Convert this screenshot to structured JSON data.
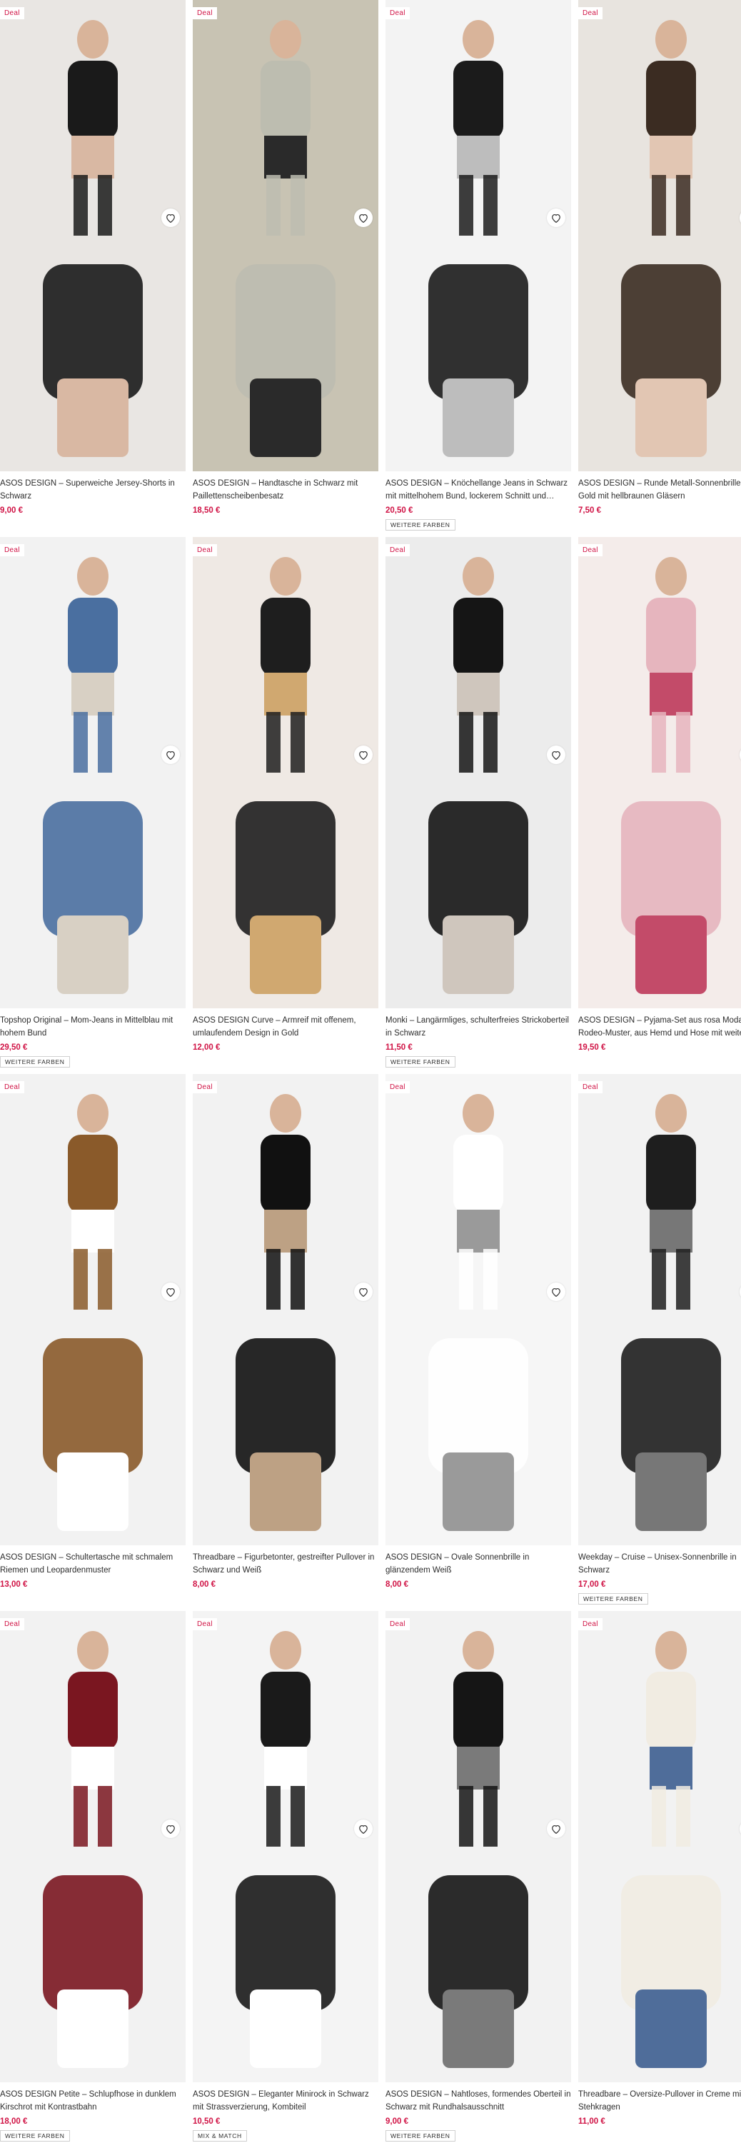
{
  "products": [
    {
      "deal": "Deal",
      "title": "ASOS DESIGN – Superweiche Jersey-Shorts in Schwarz",
      "price": "9,00 €",
      "tag": ""
    },
    {
      "deal": "Deal",
      "title": "ASOS DESIGN – Handtasche in Schwarz mit Paillettenscheibenbesatz",
      "price": "18,50 €",
      "tag": ""
    },
    {
      "deal": "Deal",
      "title": "ASOS DESIGN – Knöchellange Jeans in Schwarz mit mittelhohem Bund, lockerem Schnitt und…",
      "price": "20,50 €",
      "tag": "WEITERE FARBEN"
    },
    {
      "deal": "Deal",
      "title": "ASOS DESIGN – Runde Metall-Sonnenbrille in Gold mit hellbraunen Gläsern",
      "price": "7,50 €",
      "tag": ""
    },
    {
      "deal": "Deal",
      "title": "Topshop Original – Mom-Jeans in Mittelblau mit hohem Bund",
      "price": "29,50 €",
      "tag": "WEITERE FARBEN"
    },
    {
      "deal": "Deal",
      "title": "ASOS DESIGN Curve – Armreif mit offenem, umlaufendem Design in Gold",
      "price": "12,00 €",
      "tag": ""
    },
    {
      "deal": "Deal",
      "title": "Monki – Langärmliges, schulterfreies Strickoberteil in Schwarz",
      "price": "11,50 €",
      "tag": "WEITERE FARBEN"
    },
    {
      "deal": "Deal",
      "title": "ASOS DESIGN – Pyjama-Set aus rosa Modal mit Rodeo-Muster, aus Hemd und Hose mit weitem…",
      "price": "19,50 €",
      "tag": ""
    },
    {
      "deal": "Deal",
      "title": "ASOS DESIGN – Schultertasche mit schmalem Riemen und Leopardenmuster",
      "price": "13,00 €",
      "tag": ""
    },
    {
      "deal": "Deal",
      "title": "Threadbare – Figurbetonter, gestreifter Pullover in Schwarz und Weiß",
      "price": "8,00 €",
      "tag": ""
    },
    {
      "deal": "Deal",
      "title": "ASOS DESIGN – Ovale Sonnenbrille in glänzendem Weiß",
      "price": "8,00 €",
      "tag": ""
    },
    {
      "deal": "Deal",
      "title": "Weekday – Cruise – Unisex-Sonnenbrille in Schwarz",
      "price": "17,00 €",
      "tag": "WEITERE FARBEN"
    },
    {
      "deal": "Deal",
      "title": "ASOS DESIGN Petite – Schlupfhose in dunklem Kirschrot mit Kontrastbahn",
      "price": "18,00 €",
      "tag": "WEITERE FARBEN"
    },
    {
      "deal": "Deal",
      "title": "ASOS DESIGN – Eleganter Minirock in Schwarz mit Strassverzierung, Kombiteil",
      "price": "10,50 €",
      "tag": "MIX & MATCH"
    },
    {
      "deal": "Deal",
      "title": "ASOS DESIGN – Nahtloses, formendes Oberteil in Schwarz mit Rundhalsausschnitt",
      "price": "9,00 €",
      "tag": "WEITERE FARBEN"
    },
    {
      "deal": "Deal",
      "title": "Threadbare – Oversize-Pullover in Creme mit Stehkragen",
      "price": "11,00 €",
      "tag": ""
    }
  ],
  "colors": {
    "deal": "#d01345",
    "price": "#d01345",
    "text": "#2d2d2d"
  }
}
